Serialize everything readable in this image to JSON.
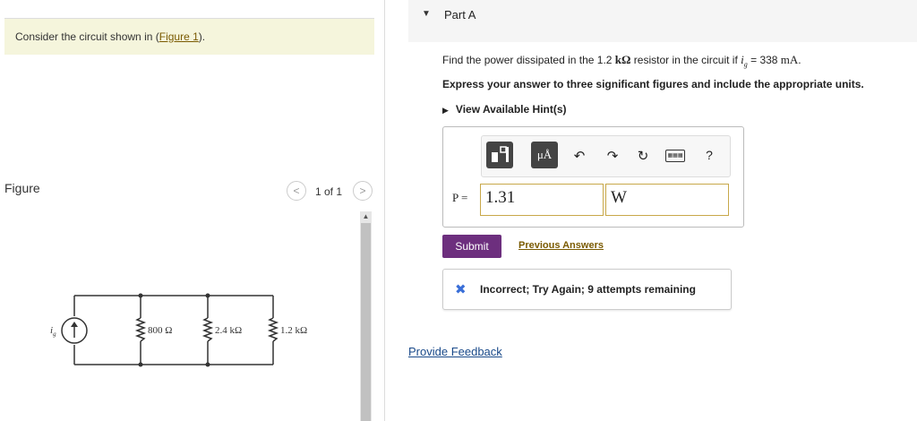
{
  "intro": {
    "text_prefix": "Consider the circuit shown in (",
    "figure_link": "Figure 1",
    "text_suffix": ")."
  },
  "figure": {
    "label": "Figure",
    "prev": "<",
    "next": ">",
    "page_count": "1 of 1",
    "source_label": "i",
    "source_sub": "g",
    "resistors": [
      "800 Ω",
      "2.4 kΩ",
      "1.2 kΩ"
    ]
  },
  "part": {
    "caret": "▼",
    "title": "Part A",
    "question_prefix": "Find the power dissipated in the 1.2 ",
    "question_unit": "kΩ",
    "question_mid": " resistor in the circuit if ",
    "question_var": "i",
    "question_sub": "g",
    "question_eq": " = 338 ",
    "question_value_unit": "mA",
    "question_end": ".",
    "express": "Express your answer to three significant figures and include the appropriate units.",
    "hints": "View Available Hint(s)"
  },
  "toolbar": {
    "units_label": "μÅ",
    "undo": "↶",
    "redo": "↷",
    "reset": "↻",
    "keyboard": "▦▦▦",
    "help": "?"
  },
  "answer": {
    "var_label": "P =",
    "value": "1.31",
    "unit": "W"
  },
  "actions": {
    "submit": "Submit",
    "previous_answers": "Previous Answers"
  },
  "feedback": {
    "icon": "✖",
    "text": "Incorrect; Try Again; 9 attempts remaining"
  },
  "footer": {
    "provide_feedback": "Provide Feedback"
  },
  "colors": {
    "submit": "#6d2f7e",
    "link": "#7a5a00",
    "intro_bg": "#f5f5dc",
    "feedback_icon": "#3a6fd8"
  }
}
